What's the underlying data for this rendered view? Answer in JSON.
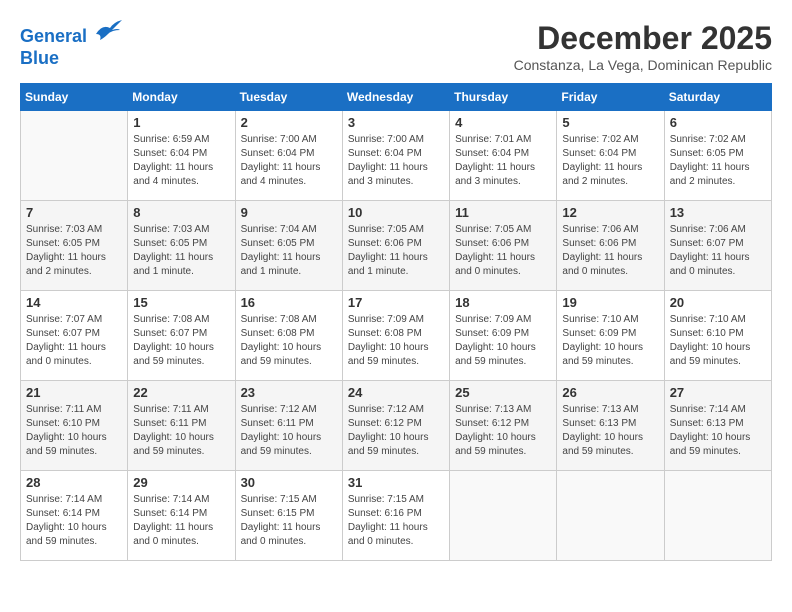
{
  "logo": {
    "line1": "General",
    "line2": "Blue"
  },
  "title": "December 2025",
  "subtitle": "Constanza, La Vega, Dominican Republic",
  "days_of_week": [
    "Sunday",
    "Monday",
    "Tuesday",
    "Wednesday",
    "Thursday",
    "Friday",
    "Saturday"
  ],
  "weeks": [
    [
      {
        "day": "",
        "info": ""
      },
      {
        "day": "1",
        "info": "Sunrise: 6:59 AM\nSunset: 6:04 PM\nDaylight: 11 hours\nand 4 minutes."
      },
      {
        "day": "2",
        "info": "Sunrise: 7:00 AM\nSunset: 6:04 PM\nDaylight: 11 hours\nand 4 minutes."
      },
      {
        "day": "3",
        "info": "Sunrise: 7:00 AM\nSunset: 6:04 PM\nDaylight: 11 hours\nand 3 minutes."
      },
      {
        "day": "4",
        "info": "Sunrise: 7:01 AM\nSunset: 6:04 PM\nDaylight: 11 hours\nand 3 minutes."
      },
      {
        "day": "5",
        "info": "Sunrise: 7:02 AM\nSunset: 6:04 PM\nDaylight: 11 hours\nand 2 minutes."
      },
      {
        "day": "6",
        "info": "Sunrise: 7:02 AM\nSunset: 6:05 PM\nDaylight: 11 hours\nand 2 minutes."
      }
    ],
    [
      {
        "day": "7",
        "info": "Sunrise: 7:03 AM\nSunset: 6:05 PM\nDaylight: 11 hours\nand 2 minutes."
      },
      {
        "day": "8",
        "info": "Sunrise: 7:03 AM\nSunset: 6:05 PM\nDaylight: 11 hours\nand 1 minute."
      },
      {
        "day": "9",
        "info": "Sunrise: 7:04 AM\nSunset: 6:05 PM\nDaylight: 11 hours\nand 1 minute."
      },
      {
        "day": "10",
        "info": "Sunrise: 7:05 AM\nSunset: 6:06 PM\nDaylight: 11 hours\nand 1 minute."
      },
      {
        "day": "11",
        "info": "Sunrise: 7:05 AM\nSunset: 6:06 PM\nDaylight: 11 hours\nand 0 minutes."
      },
      {
        "day": "12",
        "info": "Sunrise: 7:06 AM\nSunset: 6:06 PM\nDaylight: 11 hours\nand 0 minutes."
      },
      {
        "day": "13",
        "info": "Sunrise: 7:06 AM\nSunset: 6:07 PM\nDaylight: 11 hours\nand 0 minutes."
      }
    ],
    [
      {
        "day": "14",
        "info": "Sunrise: 7:07 AM\nSunset: 6:07 PM\nDaylight: 11 hours\nand 0 minutes."
      },
      {
        "day": "15",
        "info": "Sunrise: 7:08 AM\nSunset: 6:07 PM\nDaylight: 10 hours\nand 59 minutes."
      },
      {
        "day": "16",
        "info": "Sunrise: 7:08 AM\nSunset: 6:08 PM\nDaylight: 10 hours\nand 59 minutes."
      },
      {
        "day": "17",
        "info": "Sunrise: 7:09 AM\nSunset: 6:08 PM\nDaylight: 10 hours\nand 59 minutes."
      },
      {
        "day": "18",
        "info": "Sunrise: 7:09 AM\nSunset: 6:09 PM\nDaylight: 10 hours\nand 59 minutes."
      },
      {
        "day": "19",
        "info": "Sunrise: 7:10 AM\nSunset: 6:09 PM\nDaylight: 10 hours\nand 59 minutes."
      },
      {
        "day": "20",
        "info": "Sunrise: 7:10 AM\nSunset: 6:10 PM\nDaylight: 10 hours\nand 59 minutes."
      }
    ],
    [
      {
        "day": "21",
        "info": "Sunrise: 7:11 AM\nSunset: 6:10 PM\nDaylight: 10 hours\nand 59 minutes."
      },
      {
        "day": "22",
        "info": "Sunrise: 7:11 AM\nSunset: 6:11 PM\nDaylight: 10 hours\nand 59 minutes."
      },
      {
        "day": "23",
        "info": "Sunrise: 7:12 AM\nSunset: 6:11 PM\nDaylight: 10 hours\nand 59 minutes."
      },
      {
        "day": "24",
        "info": "Sunrise: 7:12 AM\nSunset: 6:12 PM\nDaylight: 10 hours\nand 59 minutes."
      },
      {
        "day": "25",
        "info": "Sunrise: 7:13 AM\nSunset: 6:12 PM\nDaylight: 10 hours\nand 59 minutes."
      },
      {
        "day": "26",
        "info": "Sunrise: 7:13 AM\nSunset: 6:13 PM\nDaylight: 10 hours\nand 59 minutes."
      },
      {
        "day": "27",
        "info": "Sunrise: 7:14 AM\nSunset: 6:13 PM\nDaylight: 10 hours\nand 59 minutes."
      }
    ],
    [
      {
        "day": "28",
        "info": "Sunrise: 7:14 AM\nSunset: 6:14 PM\nDaylight: 10 hours\nand 59 minutes."
      },
      {
        "day": "29",
        "info": "Sunrise: 7:14 AM\nSunset: 6:14 PM\nDaylight: 11 hours\nand 0 minutes."
      },
      {
        "day": "30",
        "info": "Sunrise: 7:15 AM\nSunset: 6:15 PM\nDaylight: 11 hours\nand 0 minutes."
      },
      {
        "day": "31",
        "info": "Sunrise: 7:15 AM\nSunset: 6:16 PM\nDaylight: 11 hours\nand 0 minutes."
      },
      {
        "day": "",
        "info": ""
      },
      {
        "day": "",
        "info": ""
      },
      {
        "day": "",
        "info": ""
      }
    ]
  ]
}
